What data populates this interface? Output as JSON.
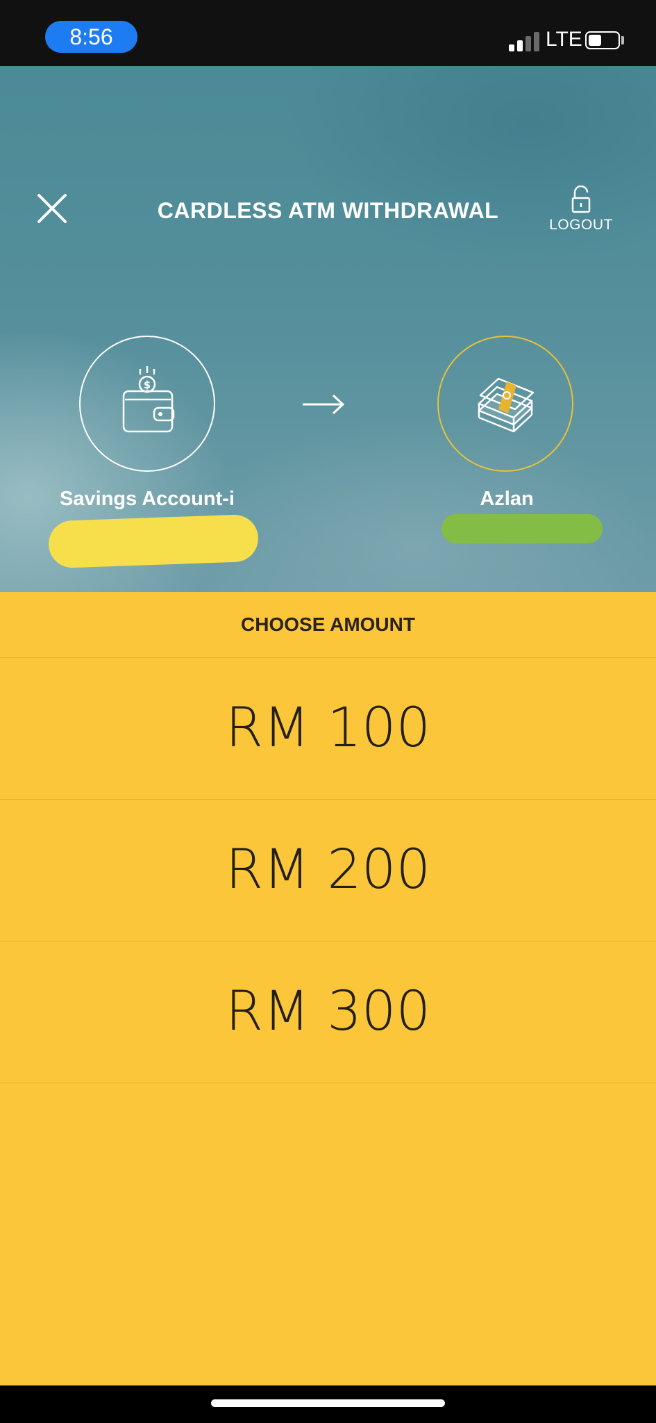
{
  "status_bar": {
    "time": "8:56",
    "network": "LTE",
    "signal_bars_active": 2,
    "signal_bars_total": 4,
    "battery_level": 0.4
  },
  "header": {
    "title": "CARDLESS ATM WITHDRAWAL",
    "close_icon": "close-icon",
    "logout_label": "LOGOUT",
    "logout_icon": "unlock-icon"
  },
  "transfer": {
    "from": {
      "label": "Savings Account-i",
      "icon": "wallet-icon"
    },
    "arrow_icon": "arrow-right-icon",
    "to": {
      "label": "Azlan",
      "icon": "cash-stack-icon"
    }
  },
  "amount_panel": {
    "heading": "CHOOSE AMOUNT",
    "options": [
      "RM 100",
      "RM 200",
      "RM 300"
    ]
  },
  "colors": {
    "panel": "#fcc63b",
    "hero": "#548f9b",
    "to_circle": "#e8c23a",
    "time_pill": "#1e7cf3",
    "redact_yellow": "#f6df4a",
    "redact_green": "#84bd46"
  }
}
